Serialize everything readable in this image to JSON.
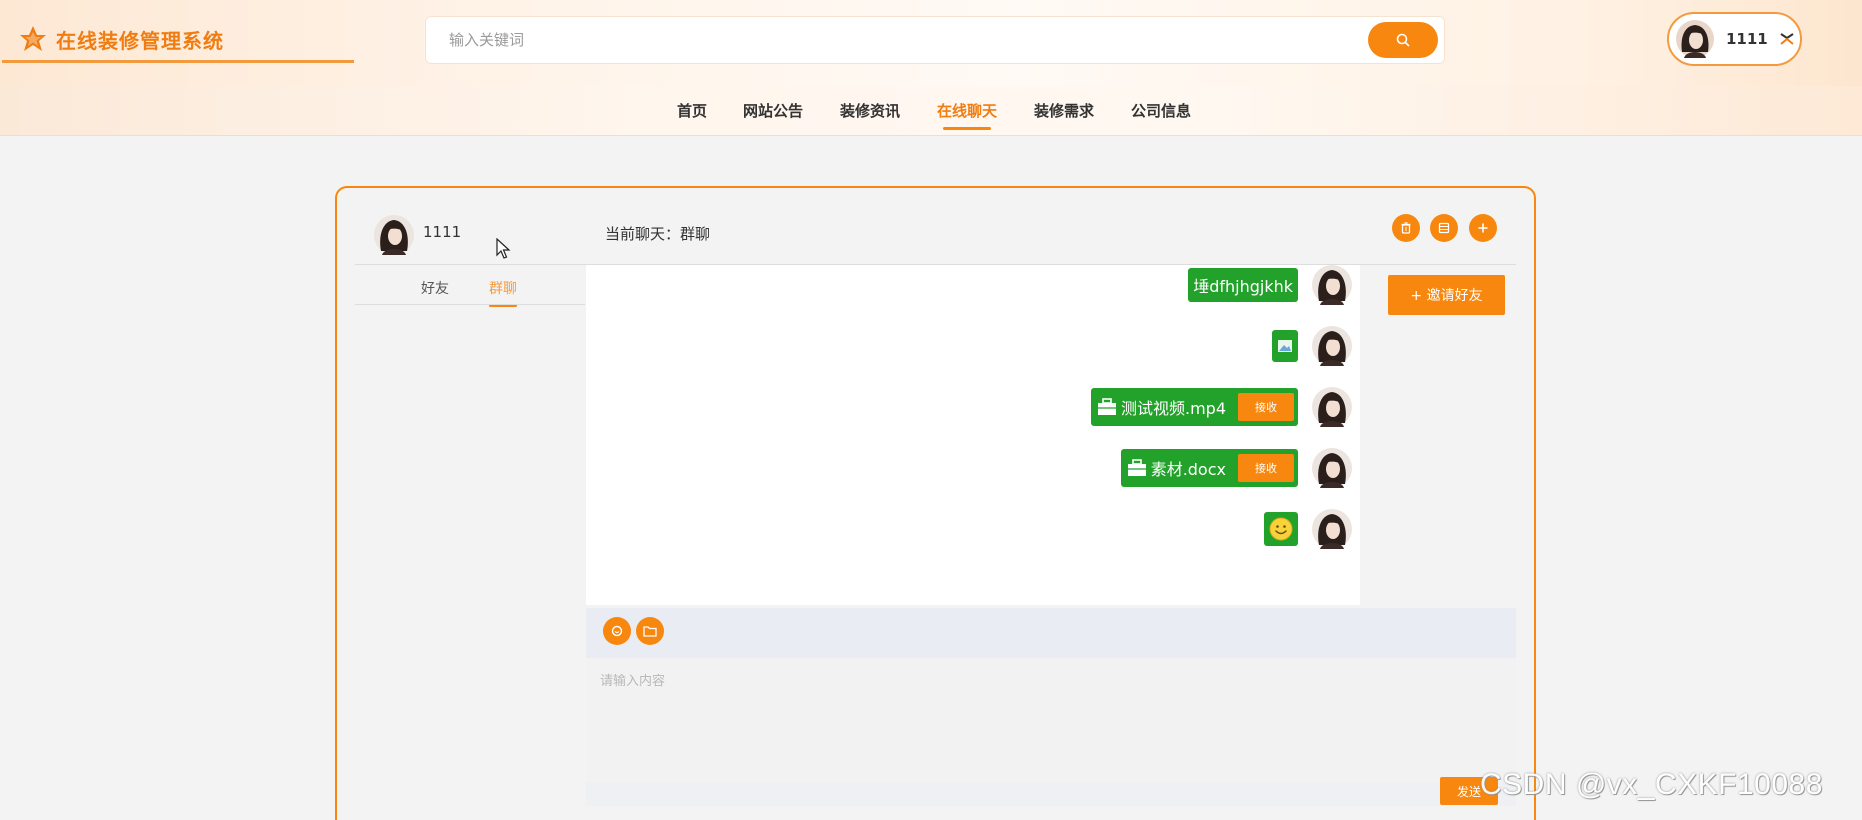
{
  "app": {
    "title": "在线装修管理系统"
  },
  "search": {
    "placeholder": "输入关键词"
  },
  "user": {
    "name": "1111"
  },
  "nav": {
    "items": [
      {
        "label": "首页"
      },
      {
        "label": "网站公告"
      },
      {
        "label": "装修资讯"
      },
      {
        "label": "在线聊天"
      },
      {
        "label": "装修需求"
      },
      {
        "label": "公司信息"
      }
    ],
    "active": "在线聊天"
  },
  "chat": {
    "me_name": "1111",
    "title": "当前聊天：群聊",
    "tabs": [
      {
        "label": "好友"
      },
      {
        "label": "群聊"
      }
    ],
    "active_tab": "群聊",
    "invite_label": "+ 邀请好友",
    "messages": [
      {
        "type": "text",
        "content": "埵dfhjhgjkhk"
      },
      {
        "type": "image"
      },
      {
        "type": "file",
        "name": "测试视频.mp4",
        "action": "接收"
      },
      {
        "type": "file",
        "name": "素材.docx",
        "action": "接收"
      },
      {
        "type": "emoji"
      }
    ],
    "input_placeholder": "请输入内容",
    "send_label": "发送"
  },
  "watermark": "CSDN @vx_CXKF10088",
  "colors": {
    "accent": "#f7870f",
    "bubble": "#22a22a",
    "panel_border": "#f7870f"
  }
}
